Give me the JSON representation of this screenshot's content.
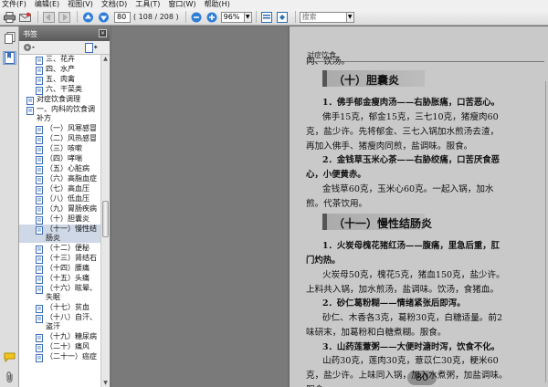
{
  "menu": [
    "文件(F)",
    "编辑(E)",
    "视图(V)",
    "文档(D)",
    "工具(T)",
    "窗口(W)",
    "帮助(H)"
  ],
  "toolbar": {
    "page_current": "80",
    "page_total": "( 108 / 208 )",
    "zoom": "96%",
    "search_placeholder": "搜索"
  },
  "bookmarks_panel": {
    "title": "书签",
    "items": [
      {
        "label": "三、花卉",
        "level": 1,
        "icon": "page"
      },
      {
        "label": "四、水产",
        "level": 1,
        "icon": "page"
      },
      {
        "label": "五、肉禽",
        "level": 1,
        "icon": "page"
      },
      {
        "label": "六、干菜类",
        "level": 1,
        "icon": "page"
      },
      {
        "label": "对症饮食调理",
        "level": 0,
        "icon": "page"
      },
      {
        "label": "一、内科的饮食调补方",
        "level": 0,
        "icon": "page"
      },
      {
        "label": "（一）风寒感冒",
        "level": 1,
        "icon": "page"
      },
      {
        "label": "（二）风热感冒",
        "level": 1,
        "icon": "page"
      },
      {
        "label": "（三）咳嗽",
        "level": 1,
        "icon": "page"
      },
      {
        "label": "（四）哮喘",
        "level": 1,
        "icon": "page"
      },
      {
        "label": "（五）心脏病",
        "level": 1,
        "icon": "page"
      },
      {
        "label": "（六）高脂血症",
        "level": 1,
        "icon": "page"
      },
      {
        "label": "（七）高血压",
        "level": 1,
        "icon": "page"
      },
      {
        "label": "（八）低血压",
        "level": 1,
        "icon": "page"
      },
      {
        "label": "（九）胃肠疾病",
        "level": 1,
        "icon": "page"
      },
      {
        "label": "（十）胆囊炎",
        "level": 1,
        "icon": "page"
      },
      {
        "label": "（十一）慢性结肠炎",
        "level": 1,
        "icon": "page",
        "selected": true
      },
      {
        "label": "（十二）便秘",
        "level": 1,
        "icon": "page"
      },
      {
        "label": "（十三）肾结石",
        "level": 1,
        "icon": "page"
      },
      {
        "label": "（十四）腰痛",
        "level": 1,
        "icon": "page"
      },
      {
        "label": "（十五）头痛",
        "level": 1,
        "icon": "page"
      },
      {
        "label": "（十六）眩晕、失眠",
        "level": 1,
        "icon": "page"
      },
      {
        "label": "（十七）贫血",
        "level": 1,
        "icon": "page"
      },
      {
        "label": "（十八）自汗、盗汗",
        "level": 1,
        "icon": "page"
      },
      {
        "label": "（十九）糖尿病",
        "level": 1,
        "icon": "page"
      },
      {
        "label": "（二十）痛风",
        "level": 1,
        "icon": "page"
      },
      {
        "label": "（二十一）癌症",
        "level": 1,
        "icon": "page"
      }
    ]
  },
  "page": {
    "running_head": "对症饮食",
    "page_number": "80",
    "lines": [
      {
        "text": "肉、饮汤。",
        "style": "body"
      },
      {
        "text": "（十）胆囊炎",
        "style": "section"
      },
      {
        "text": "1．佛手郁金瘦肉汤——右胁胀痛，口苦恶心。",
        "style": "bold"
      },
      {
        "text": "佛手15克，郁金15克，三七10克，猪瘦肉60",
        "style": "body"
      },
      {
        "text": "克，盐少许。先将郁金、三七入锅加水煎汤去渣，",
        "style": "body"
      },
      {
        "text": "再加入佛手、猪瘦肉同煎，盐调味。服食。",
        "style": "body"
      },
      {
        "text": "2．金钱草玉米心茶——右胁绞痛，口苦厌食恶",
        "style": "bold"
      },
      {
        "text": "心，小便黄赤。",
        "style": "bold"
      },
      {
        "text": "金钱草60克，玉米心60克。一起入锅，加水",
        "style": "body"
      },
      {
        "text": "煎。代茶饮用。",
        "style": "body"
      },
      {
        "text": "（十一）慢性结肠炎",
        "style": "section"
      },
      {
        "text": "1．火炭母槐花猪红汤——腹痛，里急后重，肛",
        "style": "bold"
      },
      {
        "text": "门灼热。",
        "style": "bold"
      },
      {
        "text": "火炭母50克，槐花5克，猪血150克，盐少许。",
        "style": "body"
      },
      {
        "text": "上料共入锅，加水煎汤，盐调味。饮汤，食猪血。",
        "style": "body"
      },
      {
        "text": "2．砂仁葛粉糊——情绪紧张后即泻。",
        "style": "bold"
      },
      {
        "text": "砂仁、木香各3克，葛粉30克，白糖适量。前2",
        "style": "body"
      },
      {
        "text": "味研末，加葛粉和白糖煮糊。服食。",
        "style": "body"
      },
      {
        "text": "3．山药莲薏粥——大便时溏时泻，饮食不化。",
        "style": "bold"
      },
      {
        "text": "山药30克，莲肉30克，薏苡仁30克，粳米60",
        "style": "body"
      },
      {
        "text": "克，盐少许。上味同入锅，加入水煮粥，加盐调味。",
        "style": "body"
      },
      {
        "text": "服食。",
        "style": "body"
      }
    ]
  }
}
